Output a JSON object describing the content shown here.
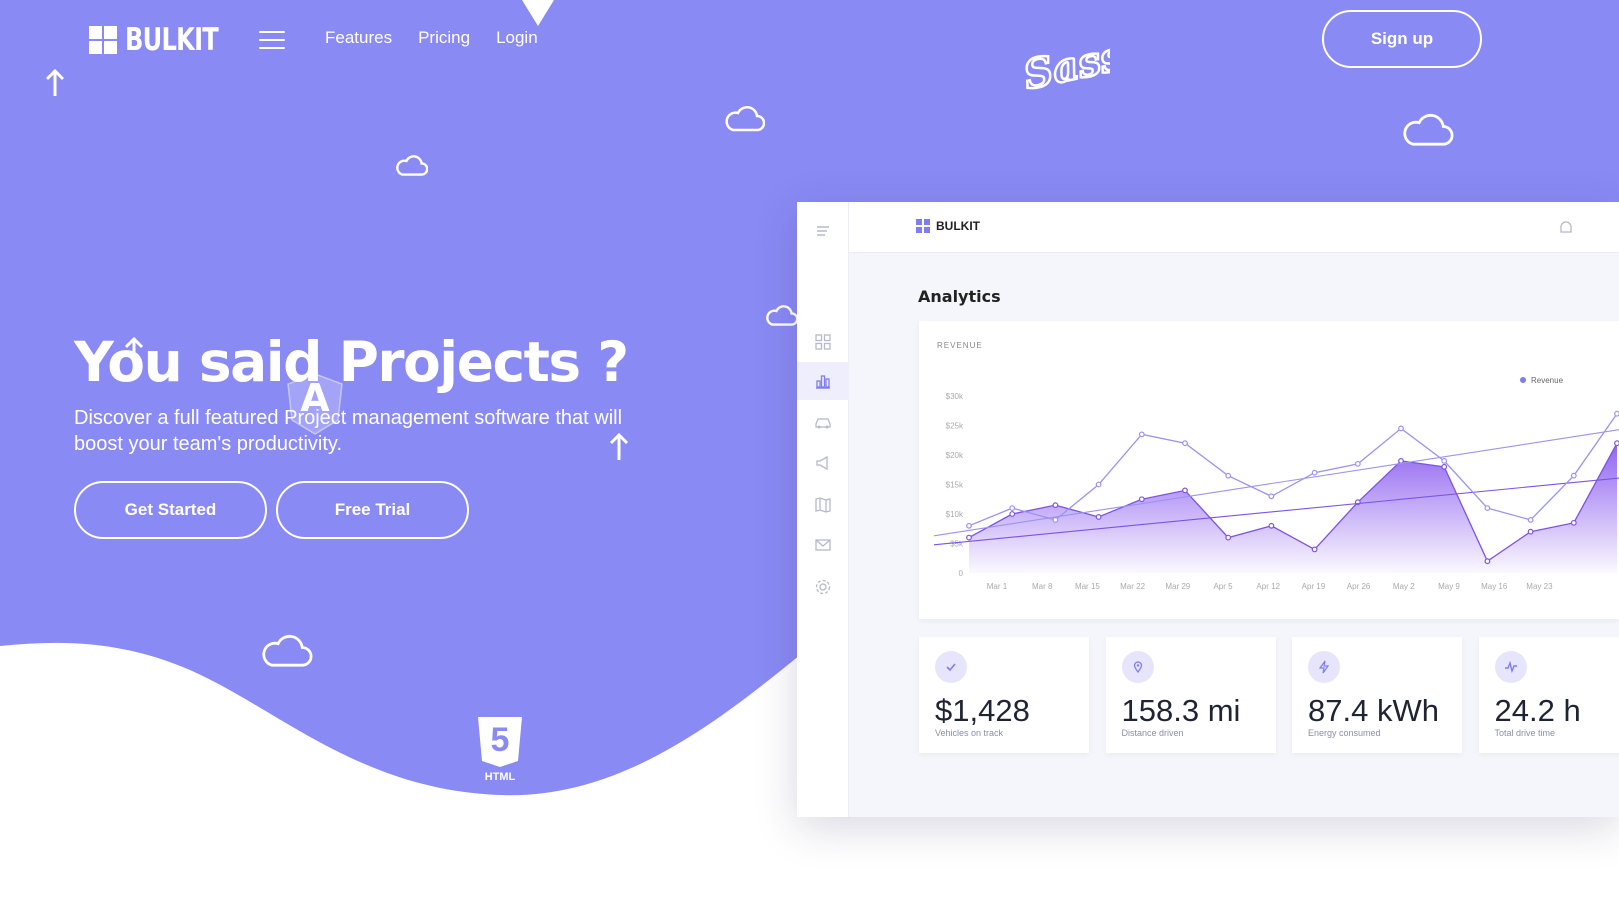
{
  "brand": {
    "name": "BULKIT"
  },
  "nav": {
    "features": "Features",
    "pricing": "Pricing",
    "login": "Login",
    "signup": "Sign up"
  },
  "hero": {
    "headline": "You said Projects ?",
    "subtext": "Discover a full featured Project management software that will boost your team's productivity.",
    "get_started": "Get Started",
    "free_trial": "Free Trial"
  },
  "decor": {
    "sass_logo_text": "Sass",
    "angular_letter": "A",
    "html5_label": "HTML",
    "html5_number": "5"
  },
  "dashboard": {
    "brand": "BULKIT",
    "title": "Analytics",
    "chart_label": "REVENUE",
    "legend": "Revenue",
    "stats": [
      {
        "icon": "check-icon",
        "value": "$1,428",
        "label": "Vehicles on track"
      },
      {
        "icon": "map-pin-icon",
        "value": "158.3 mi",
        "label": "Distance driven"
      },
      {
        "icon": "lightning-icon",
        "value": "87.4 kWh",
        "label": "Energy consumed"
      },
      {
        "icon": "activity-icon",
        "value": "24.2 h",
        "label": "Total drive time"
      }
    ]
  },
  "colors": {
    "hero_purple": "#8a8af5",
    "accent": "#7f7df2",
    "white": "#ffffff"
  },
  "chart_data": {
    "type": "area",
    "categories": [
      "Mar 1",
      "Mar 8",
      "Mar 15",
      "Mar 22",
      "Mar 29",
      "Apr 5",
      "Apr 12",
      "Apr 19",
      "Apr 26",
      "May 2",
      "May 9",
      "May 16",
      "May 23"
    ],
    "y_ticks": [
      "0",
      "$5k",
      "$10k",
      "$15k",
      "$20k",
      "$25k",
      "$30k"
    ],
    "ylim": [
      0,
      30000
    ],
    "series": [
      {
        "name": "Revenue",
        "values": [
          6000,
          10000,
          11500,
          9500,
          12500,
          14000,
          6000,
          8000,
          4000,
          12000,
          19000,
          18000,
          2000,
          7000,
          8500,
          22000
        ]
      },
      {
        "name": "",
        "values": [
          8000,
          11000,
          9000,
          15000,
          23500,
          22000,
          16500,
          13000,
          17000,
          18500,
          24500,
          19000,
          11000,
          9000,
          16500,
          27000
        ]
      }
    ]
  }
}
